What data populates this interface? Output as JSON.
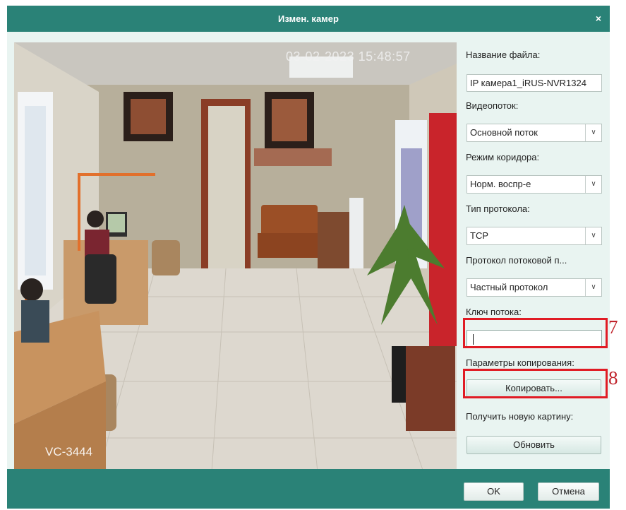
{
  "dialog": {
    "title": "Измен. камер",
    "close_glyph": "×"
  },
  "preview": {
    "timestamp": "03-02-2023 15:48:57",
    "channel_label": "VC-3444"
  },
  "form": {
    "filename_label": "Название файла:",
    "filename_value": "IP камера1_iRUS-NVR1324",
    "stream_label": "Видеопоток:",
    "stream_value": "Основной поток",
    "corridor_label": "Режим коридора:",
    "corridor_value": "Норм. воспр-е",
    "protocol_label": "Тип протокола:",
    "protocol_value": "TCP",
    "stream_protocol_label": "Протокол потоковой п...",
    "stream_protocol_value": "Частный протокол",
    "stream_key_label": "Ключ потока:",
    "stream_key_value": "",
    "copy_params_label": "Параметры копирования:",
    "copy_button": "Копировать...",
    "new_picture_label": "Получить новую картину:",
    "refresh_button": "Обновить"
  },
  "annotations": {
    "box7": "7",
    "box8": "8",
    "color": "#e01b24"
  },
  "footer": {
    "ok": "OK",
    "cancel": "Отмена"
  },
  "colors": {
    "header": "#2a8277",
    "panel_bg": "#e9f4f1"
  }
}
